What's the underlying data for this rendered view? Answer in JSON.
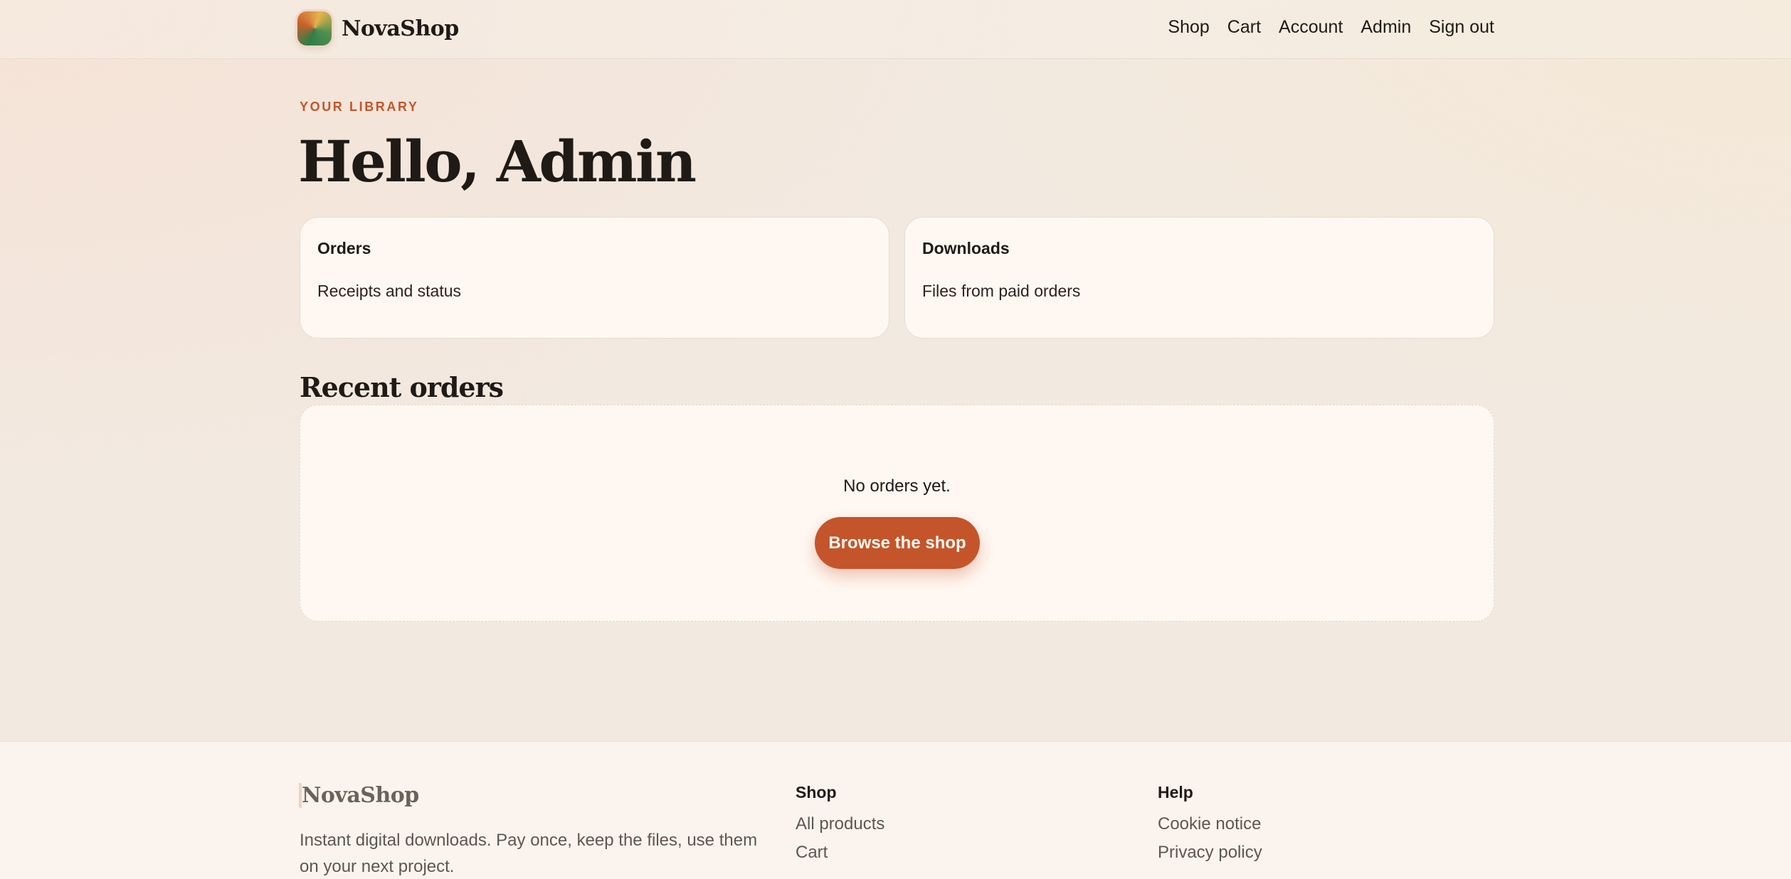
{
  "header": {
    "brand": "NovaShop",
    "nav": [
      "Shop",
      "Cart",
      "Account",
      "Admin",
      "Sign out"
    ]
  },
  "main": {
    "eyebrow": "YOUR LIBRARY",
    "greeting": "Hello, Admin",
    "cards": [
      {
        "title": "Orders",
        "description": "Receipts and status"
      },
      {
        "title": "Downloads",
        "description": "Files from paid orders"
      }
    ],
    "recent_orders": {
      "title": "Recent orders",
      "empty_text": "No orders yet.",
      "cta_label": "Browse the shop"
    }
  },
  "footer": {
    "brand": "NovaShop",
    "tagline": "Instant digital downloads. Pay once, keep the files, use them on your next project.",
    "columns": [
      {
        "title": "Shop",
        "links": [
          "All products",
          "Cart"
        ]
      },
      {
        "title": "Help",
        "links": [
          "Cookie notice",
          "Privacy policy"
        ]
      }
    ]
  },
  "colors": {
    "accent": "#c4552a",
    "background": "#f2e9e0",
    "card": "#fff8f2",
    "text": "#1f1a16"
  }
}
